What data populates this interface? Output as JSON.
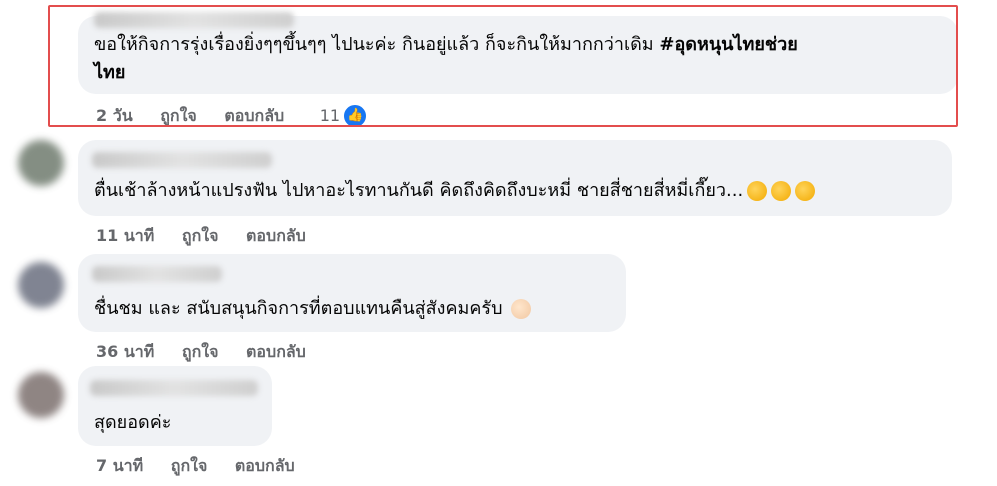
{
  "comments": [
    {
      "text_line1": "ขอให้กิจการรุ่งเรื่องยิ่งๆๆขึ้นๆๆ ไปนะค่ะ กินอยู่แล้ว ก็จะกินให้มากกว่าเดิม ",
      "hashtag": "#อุดหนุนไทยช่วย",
      "hashtag_line2": "ไทย",
      "time": "2 วัน",
      "like_label": "ถูกใจ",
      "reply_label": "ตอบกลับ",
      "reactions_count": "11"
    },
    {
      "text": "ตื่นเช้าล้างหน้าแปรงฟัน ไปหาอะไรทานกันดี คิดถึงคิดถึงบะหมี่ ชายสี่ชายสี่หมี่เกี๊ยว...",
      "time": "11 นาที",
      "like_label": "ถูกใจ",
      "reply_label": "ตอบกลับ"
    },
    {
      "text": "ชื่นชม และ สนับสนุนกิจการที่ตอบแทนคืนสู่สังคมครับ",
      "time": "36 นาที",
      "like_label": "ถูกใจ",
      "reply_label": "ตอบกลับ"
    },
    {
      "text": "สุดยอดค่ะ",
      "time": "7 นาที",
      "like_label": "ถูกใจ",
      "reply_label": "ตอบกลับ"
    }
  ],
  "icons": {
    "like_badge": "thumbs-up-icon",
    "emoji_thumbs": "thumbs-up-emoji-icon"
  },
  "colors": {
    "bubble": "#f0f2f5",
    "meta_text": "#65676b",
    "highlight_border": "#e34d4d",
    "like_blue": "#1877f2"
  }
}
